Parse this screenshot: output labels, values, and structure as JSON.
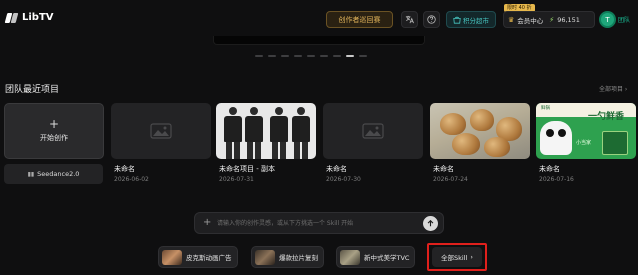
{
  "header": {
    "logo": "LibTV",
    "creator_plan": "创作者巡回赛",
    "share_label": "积分超市",
    "member_badge": "限时 40 折",
    "member_label": "会员中心",
    "credits": "96,151",
    "avatar_letter": "T",
    "team_label": "团队"
  },
  "section": {
    "title": "团队最近项目",
    "all_link": "全部项目 ›"
  },
  "create": {
    "label": "开始创作",
    "plus": "+"
  },
  "model": {
    "label": "Seedance2.0"
  },
  "projects": [
    {
      "name": "未命名",
      "date": "2026-06-02"
    },
    {
      "name": "未命名项目 - 副本",
      "date": "2026-07-31"
    },
    {
      "name": "未命名",
      "date": "2026-07-30"
    },
    {
      "name": "未命名",
      "date": "2026-07-24"
    },
    {
      "name": "未命名",
      "date": "2026-07-16"
    }
  ],
  "poster": {
    "title": "一勺鲜香",
    "tag": "鲜锅",
    "sub": "小当家"
  },
  "prompt": {
    "placeholder": "请输入你的创作灵感，或从下方挑选一个 Skill 开始"
  },
  "skills": [
    {
      "label": "皮克斯动画广告"
    },
    {
      "label": "爆款拉片复刻"
    },
    {
      "label": "新中式美学TVC"
    }
  ],
  "all_skill": {
    "label": "全部Skill"
  }
}
